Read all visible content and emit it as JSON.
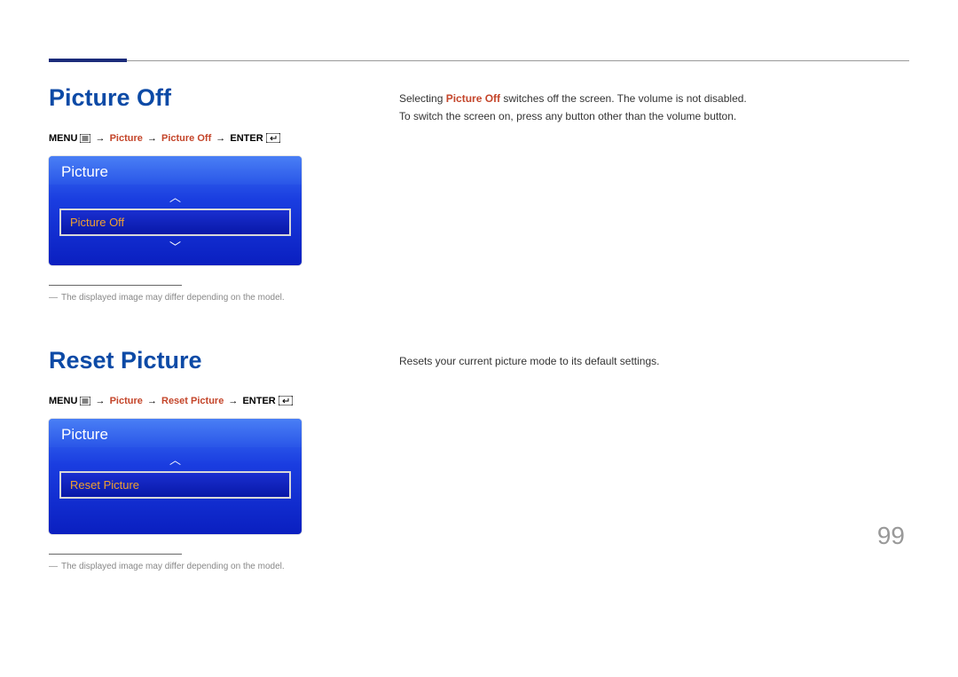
{
  "page_number": "99",
  "sections": [
    {
      "heading": "Picture Off",
      "breadcrumb": {
        "menu_label": "MENU",
        "path_highlight1": "Picture",
        "path_highlight2": "Picture Off",
        "enter_label": "ENTER"
      },
      "osd": {
        "title": "Picture",
        "selected": "Picture Off",
        "show_up": true,
        "show_down": true
      },
      "footnote": "The displayed image may differ depending on the model.",
      "description": [
        {
          "pre": "Selecting ",
          "hl": "Picture Off",
          "post": " switches off the screen. The volume is not disabled."
        },
        {
          "pre": "To switch the screen on, press any button other than the volume button.",
          "hl": "",
          "post": ""
        }
      ]
    },
    {
      "heading": "Reset Picture",
      "breadcrumb": {
        "menu_label": "MENU",
        "path_highlight1": "Picture",
        "path_highlight2": "Reset Picture",
        "enter_label": "ENTER"
      },
      "osd": {
        "title": "Picture",
        "selected": "Reset Picture",
        "show_up": true,
        "show_down": false
      },
      "footnote": "The displayed image may differ depending on the model.",
      "description": [
        {
          "pre": "Resets your current picture mode to its default settings.",
          "hl": "",
          "post": ""
        }
      ]
    }
  ]
}
